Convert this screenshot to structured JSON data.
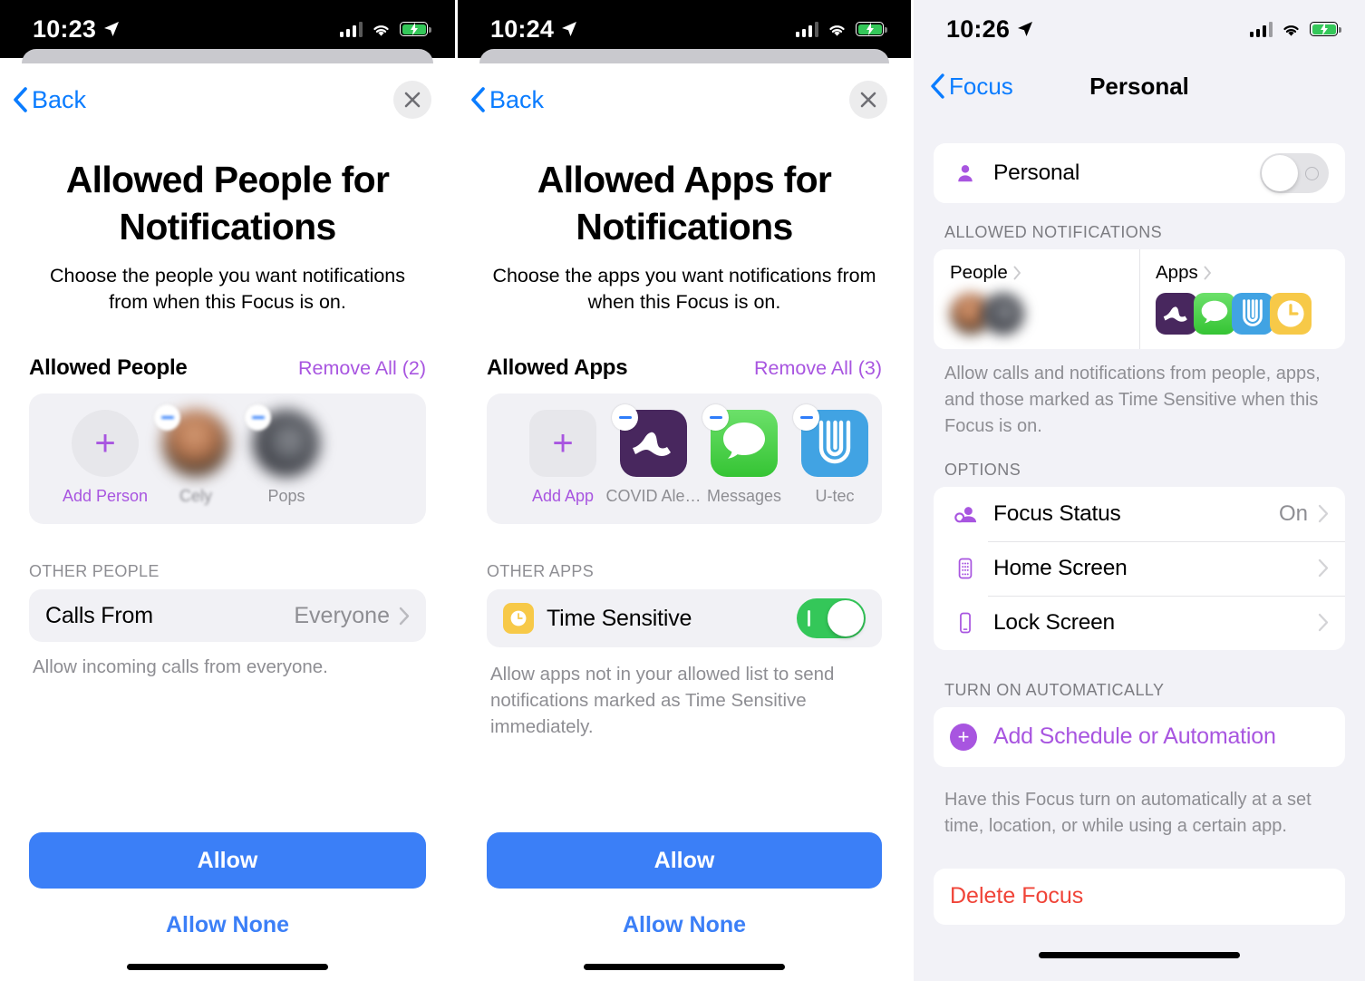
{
  "panel_people": {
    "status_bar": {
      "time": "10:23",
      "location_icon": "location-arrow-icon",
      "signal_icon": "cellular-signal-icon",
      "wifi_icon": "wifi-icon",
      "battery_icon": "battery-charging-icon"
    },
    "nav": {
      "back_label": "Back",
      "back_icon": "chevron-left-icon",
      "close_icon": "close-x-icon"
    },
    "title": "Allowed People for Notifications",
    "subtitle": "Choose the people you want notifications from when this Focus is on.",
    "section": {
      "title": "Allowed People",
      "remove_all": "Remove All (2)"
    },
    "chips": [
      {
        "label": "Add Person",
        "kind": "add",
        "icon": "plus-icon"
      },
      {
        "label": "Cely",
        "kind": "avatar",
        "icon": "person-avatar"
      },
      {
        "label": "Pops",
        "kind": "avatar",
        "icon": "person-avatar"
      }
    ],
    "other_group_label": "OTHER PEOPLE",
    "calls_row": {
      "title": "Calls From",
      "value": "Everyone",
      "chevron": "chevron-right-icon"
    },
    "calls_footnote": "Allow incoming calls from everyone.",
    "primary_button": "Allow",
    "secondary_button": "Allow None"
  },
  "panel_apps": {
    "status_bar": {
      "time": "10:24",
      "location_icon": "location-arrow-icon",
      "signal_icon": "cellular-signal-icon",
      "wifi_icon": "wifi-icon",
      "battery_icon": "battery-charging-icon"
    },
    "nav": {
      "back_label": "Back",
      "back_icon": "chevron-left-icon",
      "close_icon": "close-x-icon"
    },
    "title": "Allowed Apps for Notifications",
    "subtitle": "Choose the apps you want notifications from when this Focus is on.",
    "section": {
      "title": "Allowed Apps",
      "remove_all": "Remove All (3)"
    },
    "chips": [
      {
        "label": "Add App",
        "kind": "add",
        "icon": "plus-icon"
      },
      {
        "label": "COVID Ale…",
        "kind": "app",
        "icon": "covid-alert-ny-app-icon"
      },
      {
        "label": "Messages",
        "kind": "app",
        "icon": "messages-app-icon"
      },
      {
        "label": "U-tec",
        "kind": "app",
        "icon": "u-tec-app-icon"
      }
    ],
    "other_group_label": "OTHER APPS",
    "time_sensitive": {
      "label": "Time Sensitive",
      "icon": "clock-icon",
      "toggle_state": "on"
    },
    "time_sensitive_footnote": "Allow apps not in your allowed list to send notifications marked as Time Sensitive immediately.",
    "primary_button": "Allow",
    "secondary_button": "Allow None"
  },
  "panel_focus": {
    "status_bar": {
      "time": "10:26",
      "location_icon": "location-arrow-icon",
      "signal_icon": "cellular-signal-icon",
      "wifi_icon": "wifi-icon",
      "battery_icon": "battery-charging-icon"
    },
    "nav": {
      "back_label": "Focus",
      "back_icon": "chevron-left-icon",
      "title": "Personal"
    },
    "focus_row": {
      "label": "Personal",
      "icon": "person-fill-icon",
      "toggle_state": "off",
      "highlighted": true
    },
    "allowed_group_label": "ALLOWED NOTIFICATIONS",
    "allowed_people_col": {
      "label": "People",
      "chevron": "chevron-right-icon"
    },
    "allowed_apps_col": {
      "label": "Apps",
      "chevron": "chevron-right-icon"
    },
    "allowed_footnote": "Allow calls and notifications from people, apps, and those marked as Time Sensitive when this Focus is on.",
    "options_group_label": "OPTIONS",
    "options": [
      {
        "label": "Focus Status",
        "value": "On",
        "icon": "focus-status-icon",
        "chevron": "chevron-right-icon"
      },
      {
        "label": "Home Screen",
        "value": "",
        "icon": "home-screen-icon",
        "chevron": "chevron-right-icon"
      },
      {
        "label": "Lock Screen",
        "value": "",
        "icon": "lock-screen-icon",
        "chevron": "chevron-right-icon"
      }
    ],
    "automation_group_label": "TURN ON AUTOMATICALLY",
    "add_automation": {
      "label": "Add Schedule or Automation",
      "icon": "plus-circle-icon"
    },
    "automation_footnote": "Have this Focus turn on automatically at a set time, location, or while using a certain app.",
    "delete_label": "Delete Focus"
  },
  "colors": {
    "ios_blue": "#0a7cff",
    "button_blue": "#3b7ff7",
    "purple_accent": "#a855e0",
    "toggle_green": "#34c759",
    "destructive_red": "#f04438",
    "highlight_red": "#ee1c25",
    "grey_bg": "#f2f2f7"
  }
}
